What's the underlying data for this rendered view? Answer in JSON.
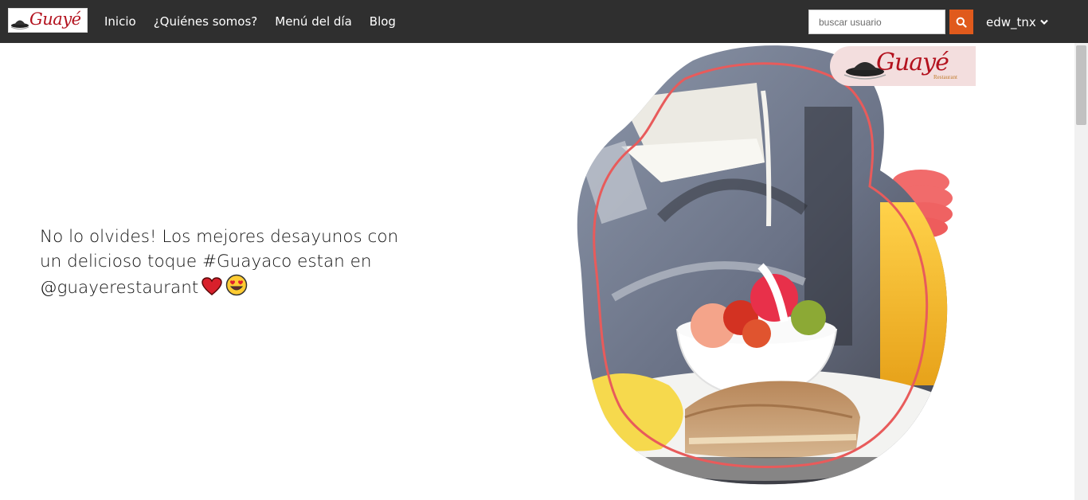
{
  "brand": {
    "logo_text": "Guayé",
    "badge_text": "Guayé",
    "badge_subtext": "Restaurant"
  },
  "nav": {
    "links": [
      {
        "label": "Inicio"
      },
      {
        "label": "¿Quiénes somos?"
      },
      {
        "label": "Menú del día"
      },
      {
        "label": "Blog"
      }
    ]
  },
  "search": {
    "placeholder": "buscar usuario",
    "value": "",
    "icon": "search-icon"
  },
  "user": {
    "name": "edw_tnx",
    "icon": "chevron-down-icon"
  },
  "hero": {
    "text": "No lo olvides! Los mejores desayunos con un delicioso toque #Guayaco estan en @guayerestaurant",
    "emojis": [
      "heart-emoji",
      "heart-eyes-emoji"
    ]
  },
  "colors": {
    "navbar": "#2f2f2f",
    "accent": "#e05a1c",
    "brand": "#b3121e",
    "ring": "#e85b5b"
  }
}
